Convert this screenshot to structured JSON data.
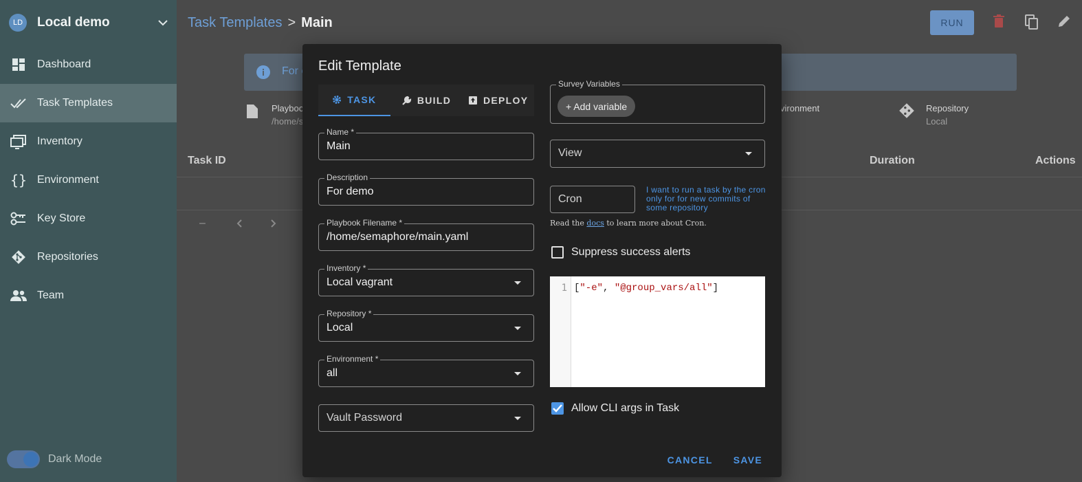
{
  "sidebar": {
    "avatar": "LD",
    "project": "Local demo",
    "items": [
      {
        "label": "Dashboard",
        "icon": "dashboard-icon"
      },
      {
        "label": "Task Templates",
        "icon": "done-all-icon",
        "active": true
      },
      {
        "label": "Inventory",
        "icon": "monitor-icon"
      },
      {
        "label": "Environment",
        "icon": "braces-icon"
      },
      {
        "label": "Key Store",
        "icon": "key-icon"
      },
      {
        "label": "Repositories",
        "icon": "git-icon"
      },
      {
        "label": "Team",
        "icon": "team-icon"
      }
    ],
    "dark_mode_label": "Dark Mode"
  },
  "header": {
    "crumb_link": "Task Templates",
    "crumb_sep": ">",
    "crumb_current": "Main",
    "run_label": "RUN"
  },
  "page": {
    "alert_text": "For c",
    "info": [
      {
        "label": "Playbook",
        "sub": "/home/s"
      },
      {
        "label": "vironment",
        "sub": ""
      },
      {
        "label": "Repository",
        "sub": "Local"
      }
    ],
    "columns": {
      "task_id": "Task ID",
      "duration": "Duration",
      "actions": "Actions"
    },
    "pager_dash": "–"
  },
  "dialog": {
    "title": "Edit Template",
    "tabs": [
      {
        "label": "TASK",
        "active": true
      },
      {
        "label": "BUILD"
      },
      {
        "label": "DEPLOY"
      }
    ],
    "fields": {
      "name": {
        "label": "Name *",
        "value": "Main"
      },
      "description": {
        "label": "Description",
        "value": "For demo"
      },
      "playbook": {
        "label": "Playbook Filename *",
        "value": "/home/semaphore/main.yaml"
      },
      "inventory": {
        "label": "Inventory *",
        "value": "Local vagrant"
      },
      "repository": {
        "label": "Repository *",
        "value": "Local"
      },
      "environment": {
        "label": "Environment *",
        "value": "all"
      },
      "vault": {
        "placeholder": "Vault Password"
      }
    },
    "survey": {
      "label": "Survey Variables",
      "add_label": "+ Add variable"
    },
    "view": {
      "placeholder": "View"
    },
    "cron": {
      "placeholder": "Cron",
      "link_text": "I want to run a task by the cron only for for new commits of some repository",
      "docs_prefix": "Read the ",
      "docs_link": "docs",
      "docs_suffix": " to learn more about Cron."
    },
    "suppress_label": "Suppress success alerts",
    "suppress_checked": false,
    "editor": {
      "line_number": "1",
      "open": "[",
      "arg1": "\"-e\"",
      "sep": ", ",
      "arg2": "\"@group_vars/all\"",
      "close": "]"
    },
    "cli_label": "Allow CLI args in Task",
    "cli_checked": true,
    "cancel_label": "CANCEL",
    "save_label": "SAVE"
  },
  "colors": {
    "accent": "#4d95e4",
    "sidebar": "#3e5659",
    "dialog": "#212121"
  }
}
